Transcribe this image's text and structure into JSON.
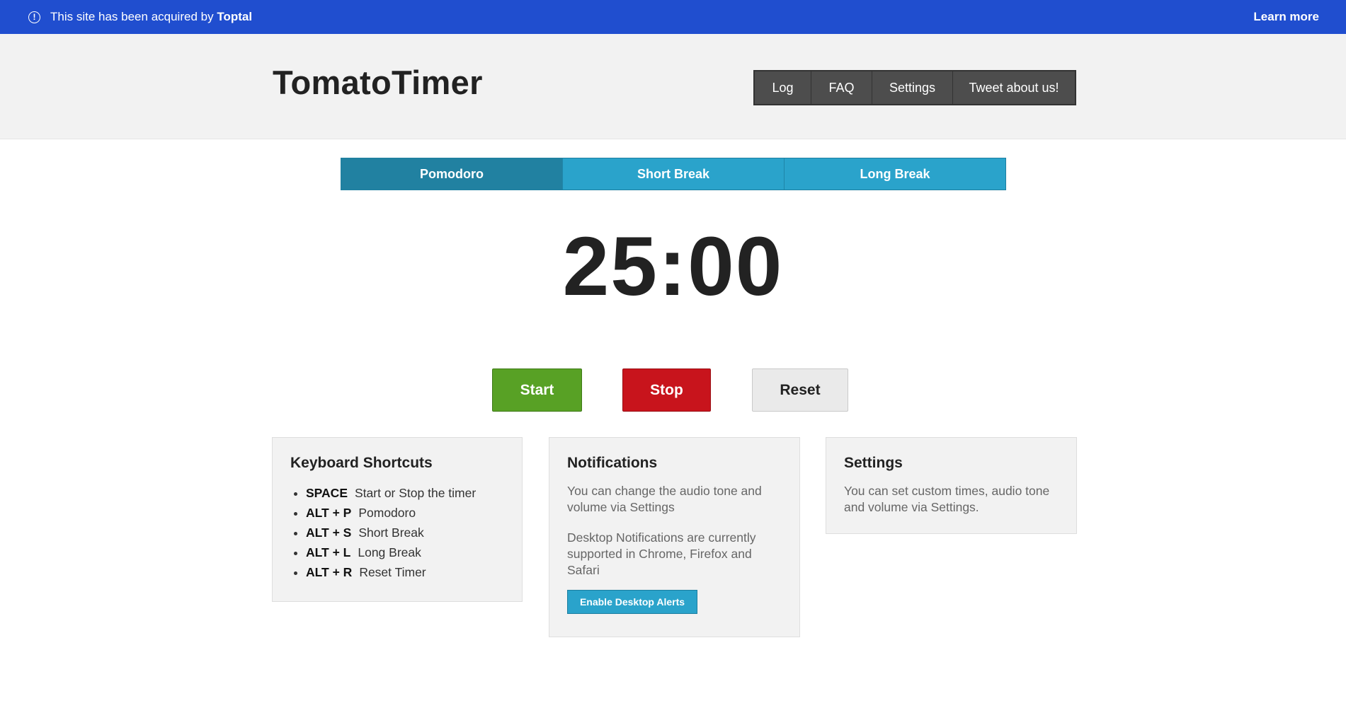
{
  "banner": {
    "message": "This site has been acquired by",
    "brand": "Toptal",
    "link_label": "Learn more",
    "color": "#204ecf"
  },
  "header": {
    "logo": "TomatoTimer",
    "nav": [
      {
        "label": "Log"
      },
      {
        "label": "FAQ"
      },
      {
        "label": "Settings"
      },
      {
        "label": "Tweet about us!"
      }
    ]
  },
  "tabs": [
    {
      "label": "Pomodoro",
      "active": true
    },
    {
      "label": "Short Break",
      "active": false
    },
    {
      "label": "Long Break",
      "active": false
    }
  ],
  "timer": {
    "display": "25:00"
  },
  "controls": {
    "start": "Start",
    "stop": "Stop",
    "reset": "Reset",
    "colors": {
      "start": "#58a125",
      "stop": "#c8141c",
      "reset": "#eaeaea"
    }
  },
  "cards": {
    "shortcuts": {
      "title": "Keyboard Shortcuts",
      "items": [
        {
          "key": "SPACE",
          "desc": "Start or Stop the timer"
        },
        {
          "key": "ALT + P",
          "desc": "Pomodoro"
        },
        {
          "key": "ALT + S",
          "desc": "Short Break"
        },
        {
          "key": "ALT + L",
          "desc": "Long Break"
        },
        {
          "key": "ALT + R",
          "desc": "Reset Timer"
        }
      ]
    },
    "notifications": {
      "title": "Notifications",
      "text1": "You can change the audio tone and volume via Settings",
      "text2": "Desktop Notifications are currently supported in Chrome, Firefox and Safari",
      "button": "Enable Desktop Alerts"
    },
    "settings": {
      "title": "Settings",
      "text": "You can set custom times, audio tone and volume via Settings."
    }
  }
}
